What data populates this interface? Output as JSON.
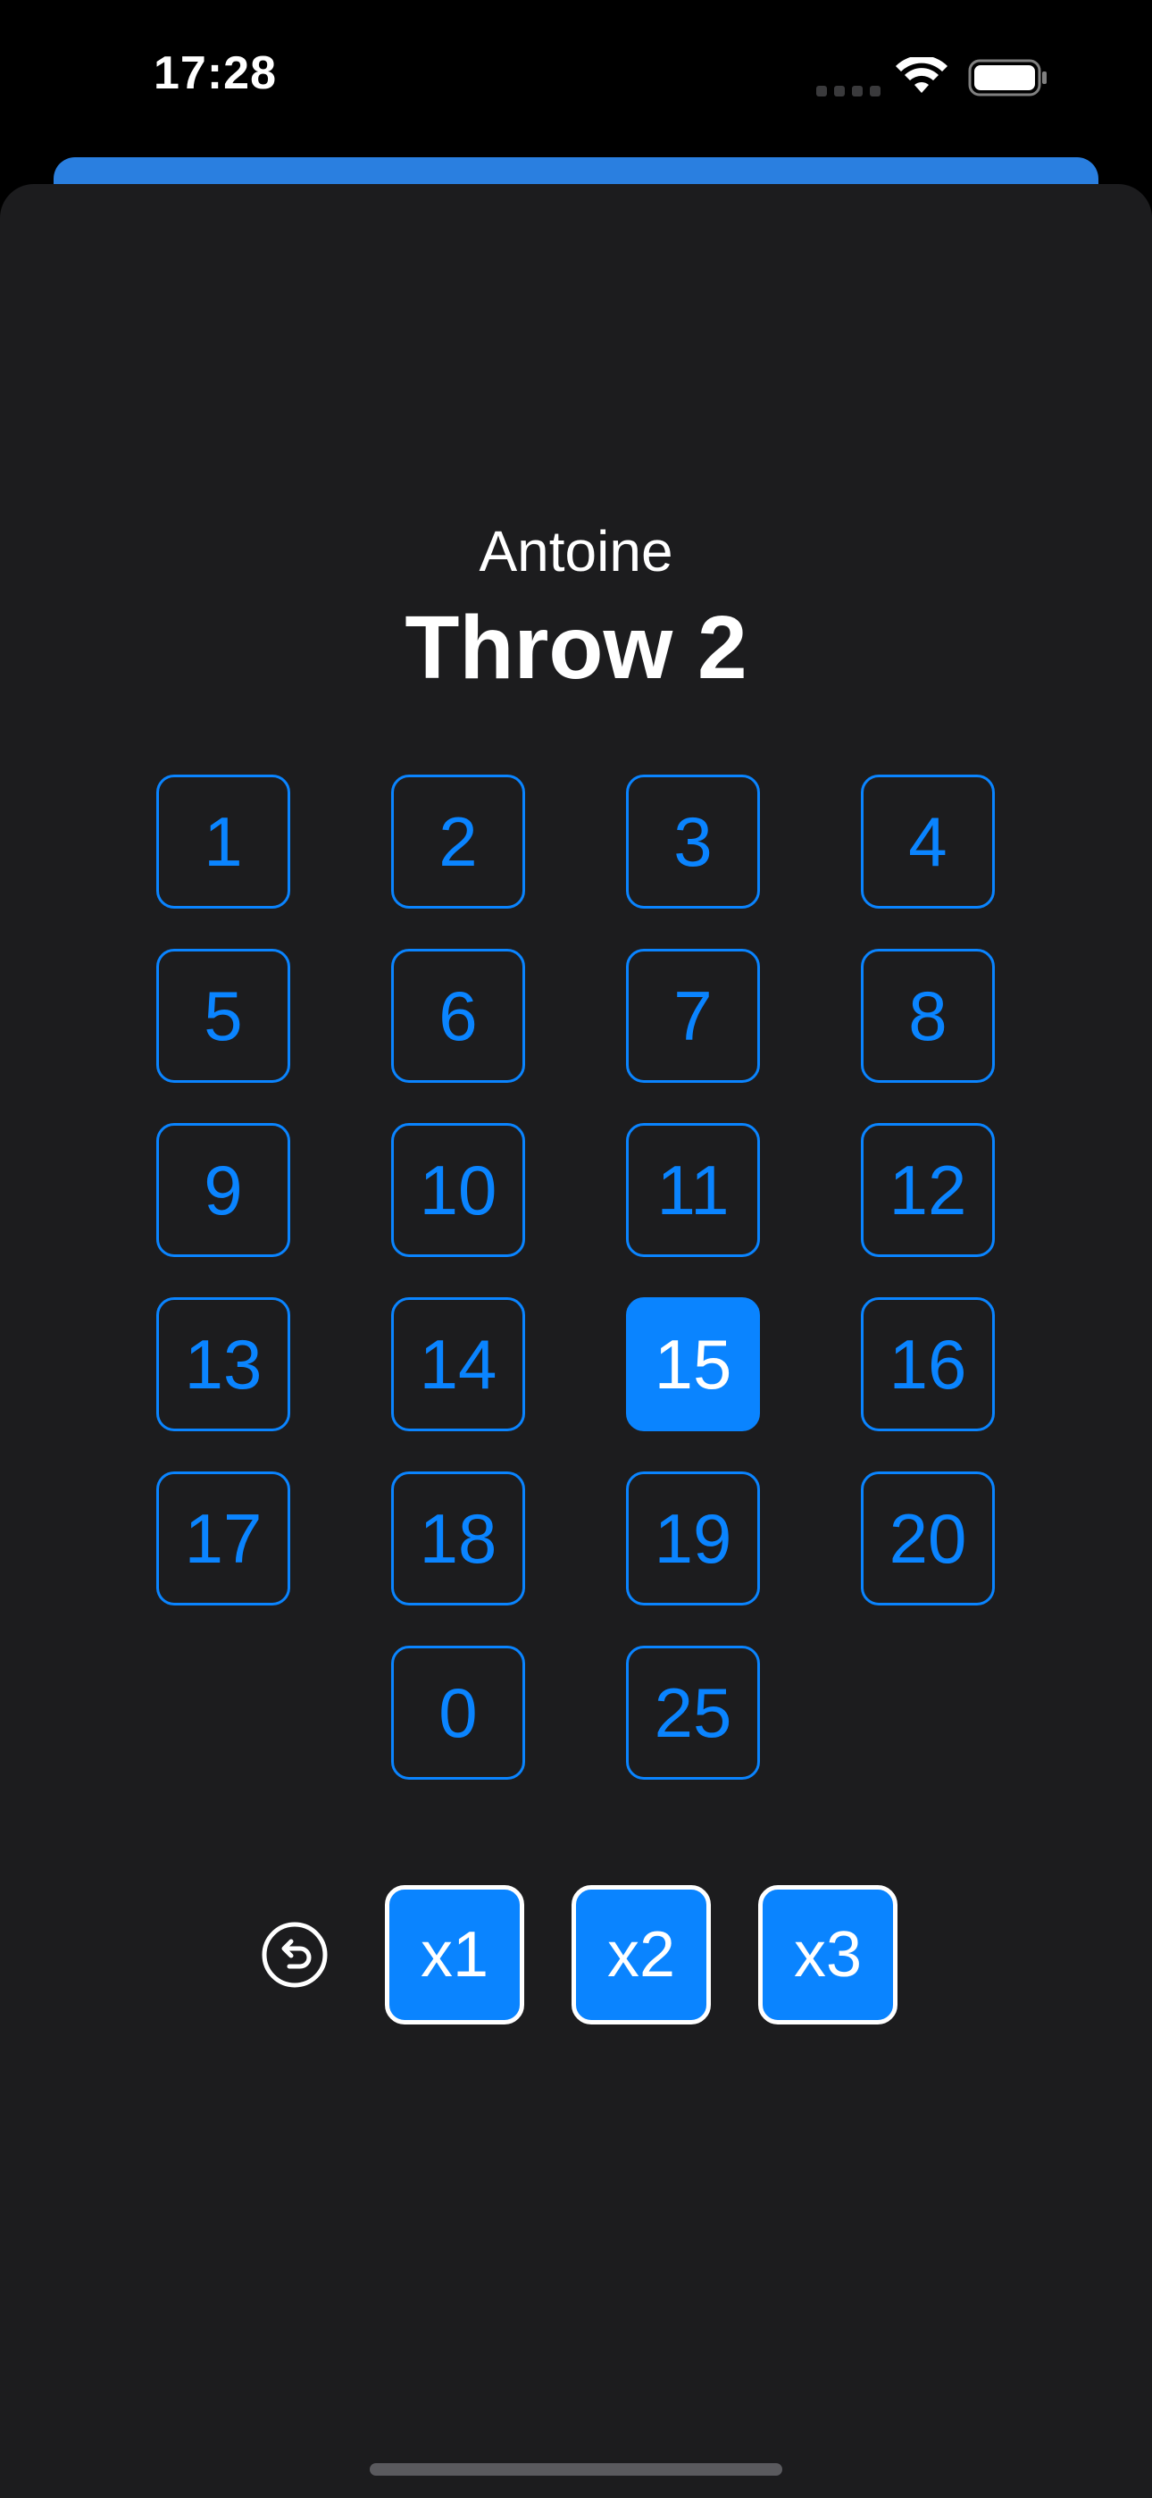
{
  "status_bar": {
    "time": "17:28",
    "icons": [
      "cellular-signal-icon",
      "wifi-icon",
      "battery-icon"
    ]
  },
  "player": {
    "name": "Antoine"
  },
  "throw": {
    "title": "Throw 2"
  },
  "numbers": [
    "1",
    "2",
    "3",
    "4",
    "5",
    "6",
    "7",
    "8",
    "9",
    "10",
    "11",
    "12",
    "13",
    "14",
    "15",
    "16",
    "17",
    "18",
    "19",
    "20"
  ],
  "extra_numbers": [
    "0",
    "25"
  ],
  "selected_number": "15",
  "multipliers": [
    "x1",
    "x2",
    "x3"
  ],
  "colors": {
    "accent": "#0a84ff",
    "sheet_background": "#1c1c1e",
    "background": "#000000",
    "text": "#ffffff"
  },
  "icons": {
    "undo": "undo-icon"
  }
}
